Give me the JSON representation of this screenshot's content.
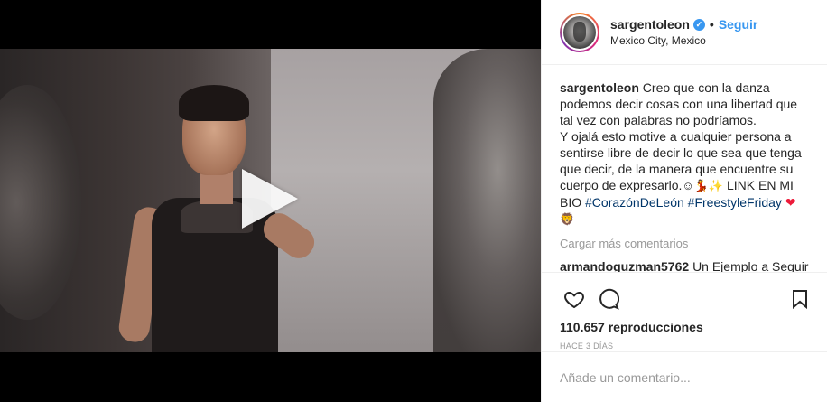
{
  "post": {
    "username": "sargentoleon",
    "verified_icon": "verified-badge-icon",
    "follow_label": "Seguir",
    "location": "Mexico City, Mexico"
  },
  "caption": {
    "username": "sargentoleon",
    "text_1": "Creo que con la danza podemos decir cosas con una libertad que tal vez con palabras no podríamos.",
    "text_2": "Y ojalá esto motive a cualquier persona a sentirse libre de decir lo que sea que tenga que decir, de la manera que encuentre su cuerpo de expresarlo.",
    "emoji_1": "☺",
    "emoji_2": "💃",
    "emoji_3": "✨",
    "text_3": "LINK EN MI BIO",
    "hashtag_1": "#CorazónDeLeón",
    "hashtag_2": "#FreestyleFriday",
    "heart": "❤",
    "lion": "🦁"
  },
  "load_more": "Cargar más comentarios",
  "comment": {
    "username": "armandoguzman5762",
    "text": "Un Ejemplo a Seguir"
  },
  "views": "110.657 reproducciones",
  "time_ago": "HACE 3 DÍAS",
  "comment_input": {
    "placeholder": "Añade un comentario..."
  },
  "colors": {
    "accent": "#3897f0",
    "hashtag": "#003569",
    "heart": "#ed1b3a",
    "muted": "#999999"
  }
}
